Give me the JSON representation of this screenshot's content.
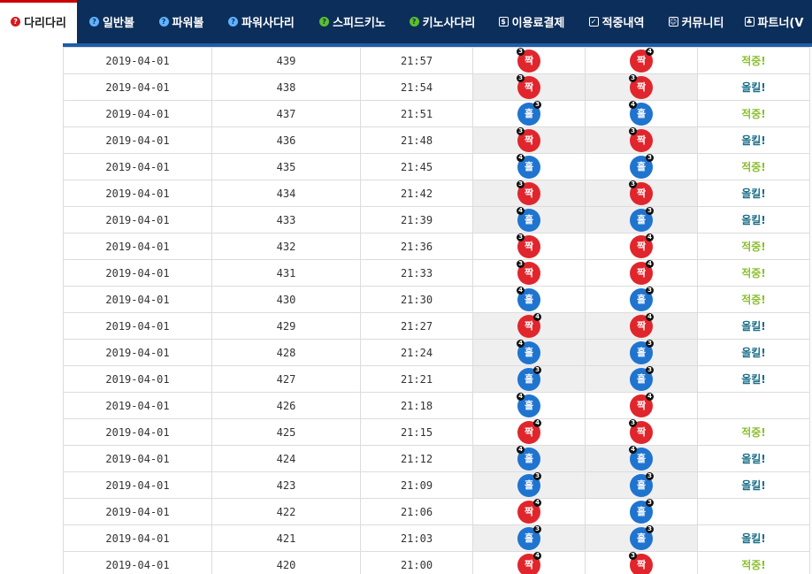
{
  "nav": {
    "items": [
      {
        "label": "다리다리",
        "icon": "question-icon",
        "active": true
      },
      {
        "label": "일반볼",
        "icon": "question-icon"
      },
      {
        "label": "파워볼",
        "icon": "question-icon"
      },
      {
        "label": "파워사다리",
        "icon": "question-icon"
      },
      {
        "label": "스피드키노",
        "icon": "question-icon"
      },
      {
        "label": "키노사다리",
        "icon": "question-icon"
      },
      {
        "label": "이용료결제",
        "icon": "payment-icon"
      },
      {
        "label": "적중내역",
        "icon": "checkbox-icon"
      },
      {
        "label": "커뮤니티",
        "icon": "smiley-icon"
      },
      {
        "label": "파트너(V",
        "icon": "partner-icon"
      }
    ]
  },
  "colors": {
    "nav_bg": "#0c2e5a",
    "even": "#e0262c",
    "odd": "#1f74cf",
    "hit": "#8bbf2e",
    "allkill": "#1b6e8a"
  },
  "rows": [
    {
      "date": "2019-04-01",
      "round": "439",
      "time": "21:57",
      "res": "짝",
      "res_n": "3",
      "res_badge": "left",
      "pick": "짝",
      "pick_n": "4",
      "pick_badge": "right",
      "status": "적중!",
      "status_type": "hit",
      "shaded": false
    },
    {
      "date": "2019-04-01",
      "round": "438",
      "time": "21:54",
      "res": "짝",
      "res_n": "3",
      "res_badge": "left",
      "pick": "짝",
      "pick_n": "3",
      "pick_badge": "left",
      "status": "올킬!",
      "status_type": "allkill",
      "shaded": true
    },
    {
      "date": "2019-04-01",
      "round": "437",
      "time": "21:51",
      "res": "홀",
      "res_n": "3",
      "res_badge": "right",
      "pick": "홀",
      "pick_n": "4",
      "pick_badge": "left",
      "status": "적중!",
      "status_type": "hit",
      "shaded": false
    },
    {
      "date": "2019-04-01",
      "round": "436",
      "time": "21:48",
      "res": "짝",
      "res_n": "3",
      "res_badge": "left",
      "pick": "짝",
      "pick_n": "3",
      "pick_badge": "left",
      "status": "올킬!",
      "status_type": "allkill",
      "shaded": true
    },
    {
      "date": "2019-04-01",
      "round": "435",
      "time": "21:45",
      "res": "홀",
      "res_n": "4",
      "res_badge": "left",
      "pick": "홀",
      "pick_n": "3",
      "pick_badge": "right",
      "status": "적중!",
      "status_type": "hit",
      "shaded": false
    },
    {
      "date": "2019-04-01",
      "round": "434",
      "time": "21:42",
      "res": "짝",
      "res_n": "3",
      "res_badge": "left",
      "pick": "짝",
      "pick_n": "3",
      "pick_badge": "left",
      "status": "올킬!",
      "status_type": "allkill",
      "shaded": true
    },
    {
      "date": "2019-04-01",
      "round": "433",
      "time": "21:39",
      "res": "홀",
      "res_n": "4",
      "res_badge": "left",
      "pick": "홀",
      "pick_n": "3",
      "pick_badge": "right",
      "status": "올킬!",
      "status_type": "allkill",
      "shaded": true
    },
    {
      "date": "2019-04-01",
      "round": "432",
      "time": "21:36",
      "res": "짝",
      "res_n": "3",
      "res_badge": "left",
      "pick": "짝",
      "pick_n": "4",
      "pick_badge": "right",
      "status": "적중!",
      "status_type": "hit",
      "shaded": false
    },
    {
      "date": "2019-04-01",
      "round": "431",
      "time": "21:33",
      "res": "짝",
      "res_n": "3",
      "res_badge": "left",
      "pick": "짝",
      "pick_n": "4",
      "pick_badge": "right",
      "status": "적중!",
      "status_type": "hit",
      "shaded": false
    },
    {
      "date": "2019-04-01",
      "round": "430",
      "time": "21:30",
      "res": "홀",
      "res_n": "4",
      "res_badge": "left",
      "pick": "홀",
      "pick_n": "3",
      "pick_badge": "right",
      "status": "적중!",
      "status_type": "hit",
      "shaded": false
    },
    {
      "date": "2019-04-01",
      "round": "429",
      "time": "21:27",
      "res": "짝",
      "res_n": "4",
      "res_badge": "right",
      "pick": "짝",
      "pick_n": "4",
      "pick_badge": "right",
      "status": "올킬!",
      "status_type": "allkill",
      "shaded": true
    },
    {
      "date": "2019-04-01",
      "round": "428",
      "time": "21:24",
      "res": "홀",
      "res_n": "4",
      "res_badge": "left",
      "pick": "홀",
      "pick_n": "3",
      "pick_badge": "right",
      "status": "올킬!",
      "status_type": "allkill",
      "shaded": true
    },
    {
      "date": "2019-04-01",
      "round": "427",
      "time": "21:21",
      "res": "홀",
      "res_n": "3",
      "res_badge": "right",
      "pick": "홀",
      "pick_n": "3",
      "pick_badge": "right",
      "status": "올킬!",
      "status_type": "allkill",
      "shaded": true
    },
    {
      "date": "2019-04-01",
      "round": "426",
      "time": "21:18",
      "res": "홀",
      "res_n": "4",
      "res_badge": "left",
      "pick": "짝",
      "pick_n": "4",
      "pick_badge": "right",
      "status": "",
      "status_type": "none",
      "shaded": false
    },
    {
      "date": "2019-04-01",
      "round": "425",
      "time": "21:15",
      "res": "짝",
      "res_n": "4",
      "res_badge": "right",
      "pick": "짝",
      "pick_n": "3",
      "pick_badge": "left",
      "status": "적중!",
      "status_type": "hit",
      "shaded": false
    },
    {
      "date": "2019-04-01",
      "round": "424",
      "time": "21:12",
      "res": "홀",
      "res_n": "4",
      "res_badge": "left",
      "pick": "홀",
      "pick_n": "4",
      "pick_badge": "left",
      "status": "올킬!",
      "status_type": "allkill",
      "shaded": true
    },
    {
      "date": "2019-04-01",
      "round": "423",
      "time": "21:09",
      "res": "홀",
      "res_n": "3",
      "res_badge": "right",
      "pick": "홀",
      "pick_n": "3",
      "pick_badge": "right",
      "status": "올킬!",
      "status_type": "allkill",
      "shaded": true
    },
    {
      "date": "2019-04-01",
      "round": "422",
      "time": "21:06",
      "res": "짝",
      "res_n": "4",
      "res_badge": "right",
      "pick": "홀",
      "pick_n": "3",
      "pick_badge": "right",
      "status": "",
      "status_type": "none",
      "shaded": false
    },
    {
      "date": "2019-04-01",
      "round": "421",
      "time": "21:03",
      "res": "홀",
      "res_n": "3",
      "res_badge": "right",
      "pick": "홀",
      "pick_n": "3",
      "pick_badge": "right",
      "status": "올킬!",
      "status_type": "allkill",
      "shaded": true
    },
    {
      "date": "2019-04-01",
      "round": "420",
      "time": "21:00",
      "res": "짝",
      "res_n": "4",
      "res_badge": "right",
      "pick": "짝",
      "pick_n": "3",
      "pick_badge": "left",
      "status": "적중!",
      "status_type": "hit",
      "shaded": false
    }
  ]
}
